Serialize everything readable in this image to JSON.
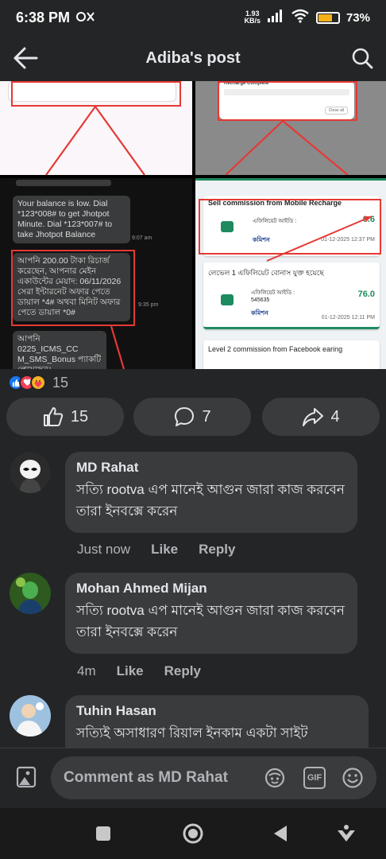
{
  "status": {
    "time": "6:38 PM",
    "net_speed_value": "1.93",
    "net_speed_unit": "KB/s",
    "battery_pct": "73%",
    "battery_level": 0.73
  },
  "header": {
    "title": "Adiba's post",
    "back_icon": "arrow-left-icon",
    "search_icon": "search-icon"
  },
  "post_images": {
    "top_right_title": "Recharge Complete",
    "top_right_button": "Close all",
    "sms1": "Your balance is low. Dial *123*008# to get Jhotpot Minute. Dial *123*007# to take Jhotpot Balance",
    "sms1_time": "9:07 am",
    "sms2": "আপনি 200.00 টাকা রিচার্জ করেছেন, আপনার মেইন একাউন্টের মেয়াদ: 06/11/2026 সেরা ইন্টারনেট অফার পেতে ডায়াল *4# অথবা মিনিট অফার পেতে ডায়াল *0#",
    "sms2_time": "9:35 pm",
    "sms3": "আপনি 0225_ICMS_CC M_SMS_Bonus প্যাকটি পেয়েছেন।",
    "card1_title": "Sell commission from Mobile Recharge",
    "card1_label": "এফিলিয়েট আইডি :",
    "card1_value": "0.6",
    "card1_sub": "কমিশন",
    "card1_date": "01-12-2025 12:37 PM",
    "card2_title": "লেভেল 1 এফিলিয়েট বোনাস যুক্ত হয়েছে",
    "card2_label": "এফিলিয়েট আইডি :",
    "card2_id": "545635",
    "card2_value": "76.0",
    "card2_sub": "কমিশন",
    "card2_date": "01-12-2025 12:11 PM",
    "card3_title": "Level 2 commission from Facebook earing"
  },
  "reactions": {
    "count": "15",
    "icons": [
      "like-icon",
      "love-icon",
      "care-icon"
    ]
  },
  "actions": {
    "like_count": "15",
    "comment_count": "7",
    "share_count": "4"
  },
  "comments": [
    {
      "name": "MD Rahat",
      "text": "সত্যি rootva এপ মানেই আগুন জারা কাজ করবেন তারা ইনবক্সে করেন",
      "time": "Just now",
      "like": "Like",
      "reply": "Reply"
    },
    {
      "name": "Mohan Ahmed Mijan",
      "text": "সত্যি rootva এপ মানেই আগুন জারা কাজ করবেন তারা ইনবক্সে করেন",
      "time": "4m",
      "like": "Like",
      "reply": "Reply"
    },
    {
      "name": "Tuhin Hasan",
      "text": "সত্যিই অসাধারণ রিয়াল ইনকাম একটা সাইট"
    }
  ],
  "composer": {
    "placeholder": "Comment as MD Rahat",
    "gif_label": "GIF"
  },
  "colors": {
    "background": "#242526",
    "bubble": "#3a3b3c",
    "accent_red": "#e53935",
    "muted": "#b0b3b8"
  }
}
